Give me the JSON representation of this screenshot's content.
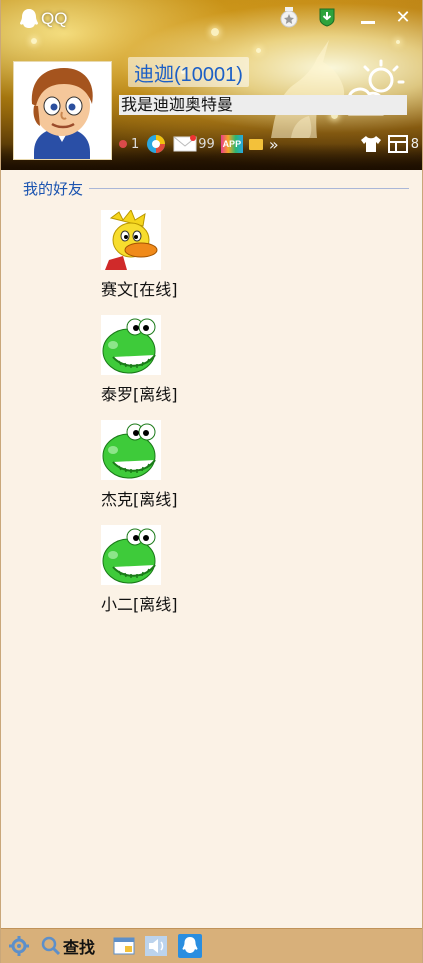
{
  "window": {
    "app_name": "QQ"
  },
  "profile": {
    "nickname": "迪迦(10001)",
    "signature": "我是迪迦奥特曼",
    "status_items": [
      {
        "icon": "level-icon",
        "value": "1"
      },
      {
        "icon": "browser-icon",
        "value": ""
      },
      {
        "icon": "mail-icon",
        "value": "99"
      },
      {
        "icon": "app-icon",
        "value": ""
      },
      {
        "icon": "folder-icon",
        "value": ""
      },
      {
        "icon": "more-icon",
        "value": "»"
      }
    ],
    "app_box_count": "8"
  },
  "group": {
    "title": "我的好友"
  },
  "friends": [
    {
      "name": "赛文[在线]",
      "avatar": "duck-avatar",
      "online": true
    },
    {
      "name": "泰罗[离线]",
      "avatar": "frog-avatar",
      "online": false
    },
    {
      "name": "杰克[离线]",
      "avatar": "frog-avatar",
      "online": false
    },
    {
      "name": "小二[离线]",
      "avatar": "frog-avatar",
      "online": false
    }
  ],
  "bottom": {
    "find_label": "查找"
  },
  "colors": {
    "nickname": "#1c5fc6",
    "group_title": "#1b54b0",
    "list_bg": "#fbf2e6",
    "bottom_bar": "#d8b07a"
  }
}
